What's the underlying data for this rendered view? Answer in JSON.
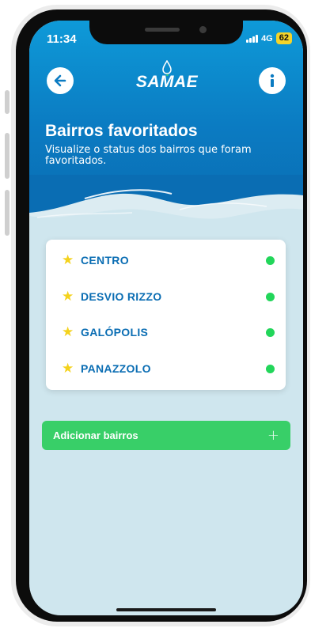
{
  "status_bar": {
    "time": "11:34",
    "network": "4G",
    "battery": "62"
  },
  "header": {
    "logo_text": "SAMAE",
    "back_icon": "back-arrow-icon",
    "info_icon": "info-icon"
  },
  "page": {
    "title": "Bairros favoritados",
    "subtitle": "Visualize o status dos bairros que foram favoritados."
  },
  "favorites": [
    {
      "name": "CENTRO",
      "status_color": "#22d65a"
    },
    {
      "name": "DESVIO RIZZO",
      "status_color": "#22d65a"
    },
    {
      "name": "GALÓPOLIS",
      "status_color": "#22d65a"
    },
    {
      "name": "PANAZZOLO",
      "status_color": "#22d65a"
    }
  ],
  "actions": {
    "add_label": "Adicionar bairros",
    "add_icon": "+"
  },
  "colors": {
    "primary_blue": "#0b7bc2",
    "accent_green": "#38cf68",
    "star_yellow": "#f4d21c",
    "background": "#cfe6ee"
  }
}
